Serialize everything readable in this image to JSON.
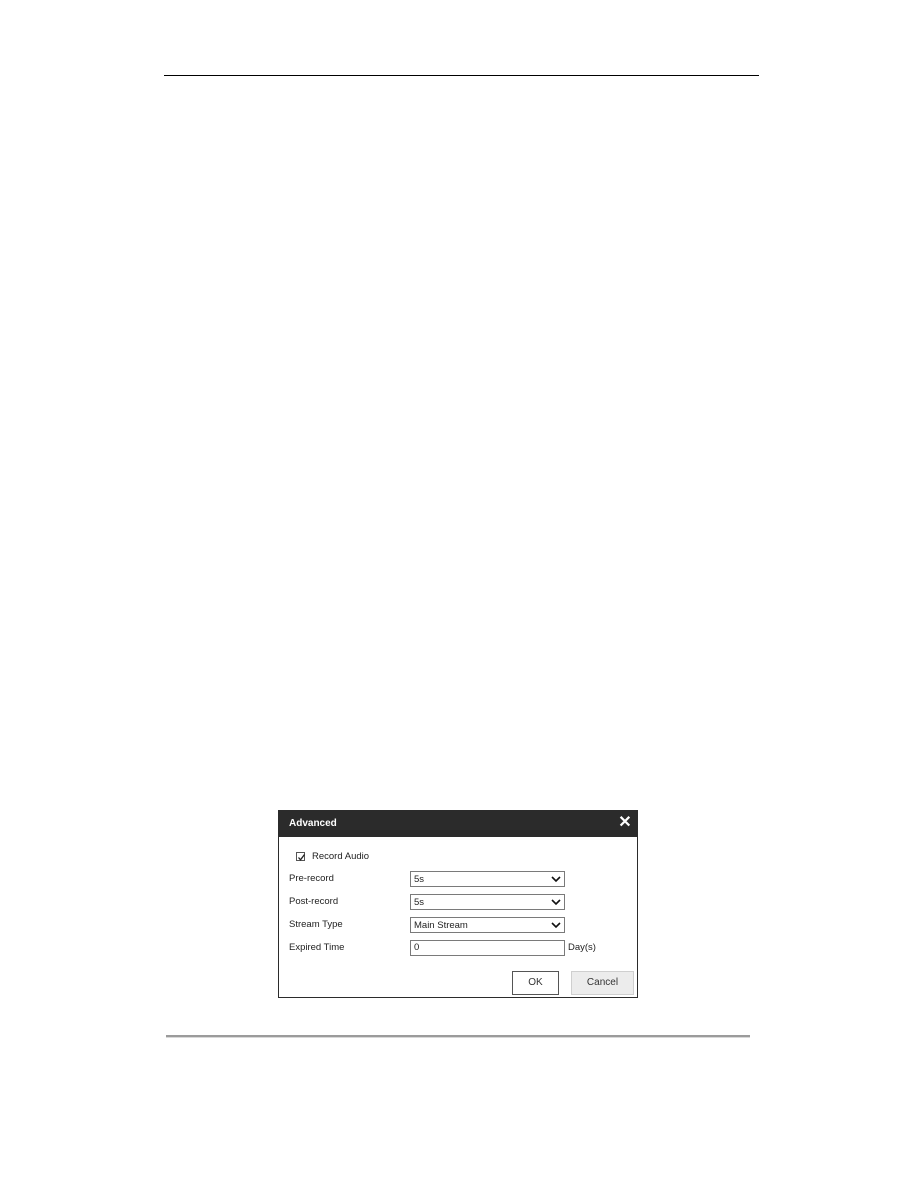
{
  "dialog": {
    "title": "Advanced",
    "close_icon": "close-icon",
    "record_audio": {
      "label": "Record Audio",
      "checked": true
    },
    "fields": [
      {
        "label": "Pre-record",
        "type": "select",
        "value": "5s"
      },
      {
        "label": "Post-record",
        "type": "select",
        "value": "5s"
      },
      {
        "label": "Stream Type",
        "type": "select",
        "value": "Main Stream"
      },
      {
        "label": "Expired Time",
        "type": "text",
        "value": "0",
        "unit": "Day(s)"
      }
    ],
    "buttons": {
      "ok": "OK",
      "cancel": "Cancel"
    }
  }
}
